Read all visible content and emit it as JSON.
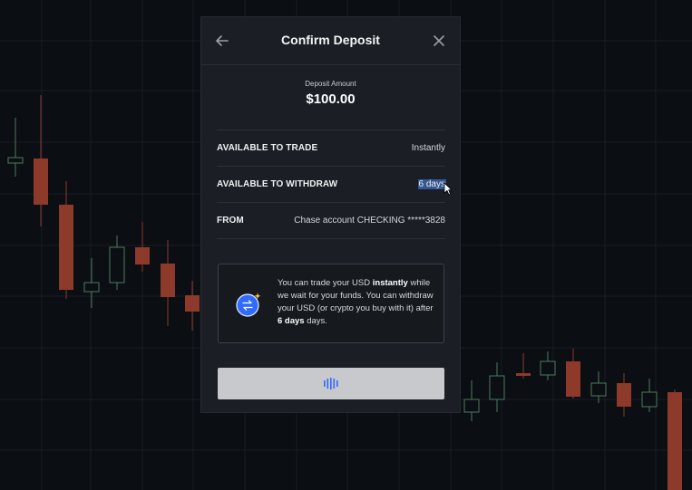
{
  "modal": {
    "title": "Confirm Deposit",
    "back_icon": "arrow-left-icon",
    "close_icon": "close-icon"
  },
  "deposit": {
    "label": "Deposit Amount",
    "amount": "$100.00"
  },
  "details": [
    {
      "key": "AVAILABLE TO TRADE",
      "value": "Instantly"
    },
    {
      "key": "AVAILABLE TO WITHDRAW",
      "value": "6 days"
    },
    {
      "key": "FROM",
      "value": "Chase account CHECKING *****3828"
    }
  ],
  "info": {
    "icon": "swap-sparkle-icon",
    "t1": "You can trade your USD ",
    "t2": "instantly",
    "t3": " while we wait for your funds. You can withdraw your USD (or crypto you buy with it) after ",
    "t4": "6 days",
    "t5": " days."
  },
  "confirm_button": {
    "icon": "loading-bars-icon"
  },
  "colors": {
    "background": "#0b0e13",
    "modal": "#1b1f25",
    "accent": "#2f6bff",
    "bear": "#8e3a2a",
    "bull": "#4f7a5c",
    "selection": "#34588f",
    "button": "#c7c9cc"
  }
}
